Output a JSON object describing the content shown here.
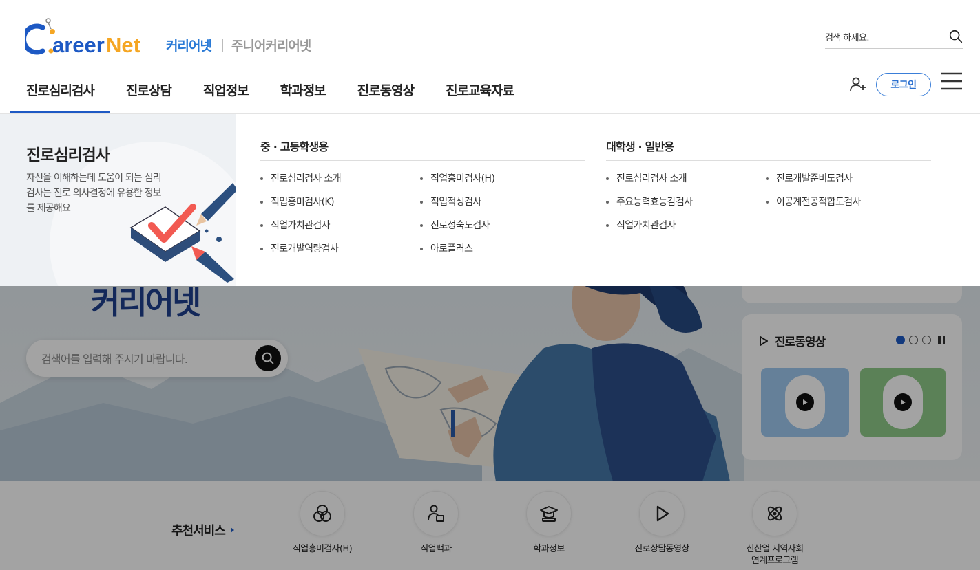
{
  "header": {
    "logo_text_1": "areer",
    "logo_text_2": "Net",
    "site_main": "커리어넷",
    "site_junior": "주니어커리어넷",
    "search_label": "검색 하세요.",
    "login_label": "로그인"
  },
  "gnb": [
    {
      "label": "진로심리검사"
    },
    {
      "label": "진로상담"
    },
    {
      "label": "직업정보"
    },
    {
      "label": "학과정보"
    },
    {
      "label": "진로동영상"
    },
    {
      "label": "진로교육자료"
    }
  ],
  "mega": {
    "title": "진로심리검사",
    "desc": "자신을 이해하는데 도움이 되는 심리검사는 진로 의사결정에 유용한 정보를 제공해요",
    "groups": [
      {
        "title": "중 · 고등학생용",
        "col1": [
          "진로심리검사 소개",
          "직업흥미검사(K)",
          "직업가치관검사",
          "진로개발역량검사"
        ],
        "col2": [
          "직업흥미검사(H)",
          "직업적성검사",
          "진로성숙도검사",
          "아로플러스"
        ]
      },
      {
        "title": "대학생 · 일반용",
        "col1": [
          "진로심리검사 소개",
          "주요능력효능감검사",
          "직업가치관검사"
        ],
        "col2": [
          "진로개발준비도검사",
          "이공계전공적합도검사"
        ]
      }
    ]
  },
  "hero": {
    "headline": "커리어넷",
    "search_placeholder": "검색어를 입력해 주시기 바랍니다."
  },
  "video": {
    "title": "진로동영상"
  },
  "reco": {
    "title": "추천서비스",
    "items": [
      {
        "label": "직업흥미검사(H)",
        "icon": "venn-icon"
      },
      {
        "label": "직업백과",
        "icon": "person-book-icon"
      },
      {
        "label": "학과정보",
        "icon": "graduation-cap-icon"
      },
      {
        "label": "진로상담동영상",
        "icon": "play-icon"
      },
      {
        "label": "신산업 지역사회\n연계프로그램",
        "icon": "atom-icon"
      }
    ]
  },
  "colors": {
    "brand_blue": "#1d59c4",
    "brand_orange": "#f5a623",
    "login_blue": "#3a7ed8"
  }
}
